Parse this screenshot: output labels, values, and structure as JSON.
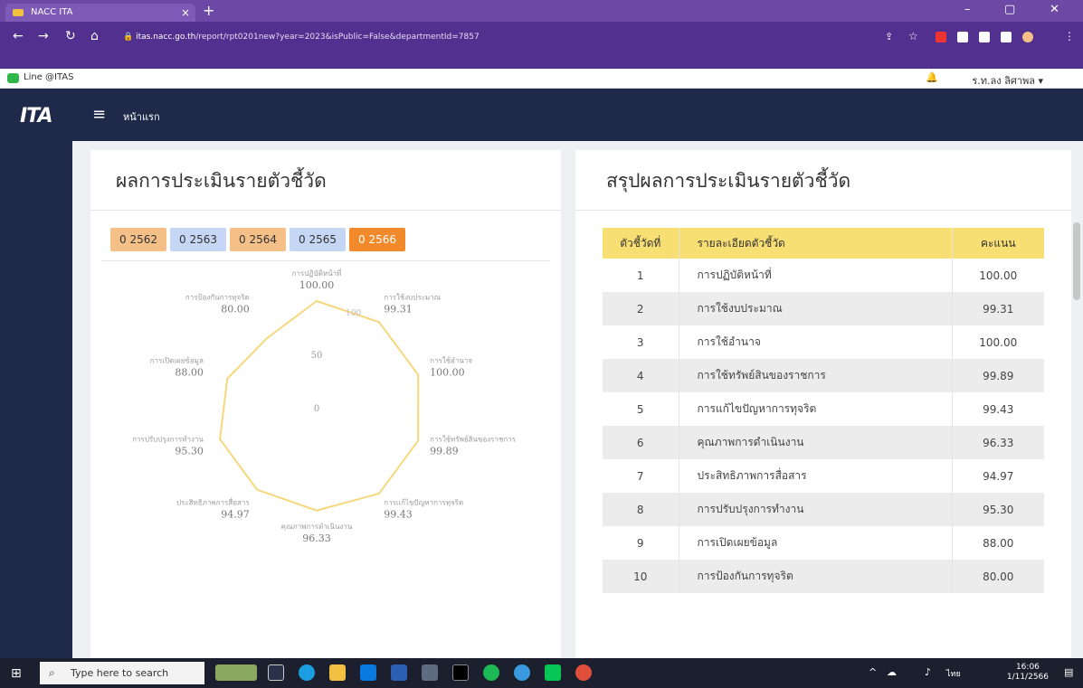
{
  "browser": {
    "tab_title": "NACC ITA",
    "tab_close": "×",
    "new_tab": "+",
    "url_host": "itas.nacc.go.th",
    "url_path": "/report/rpt0201new?year=2023&isPublic=False&departmentId=7857",
    "bookmark": "Line @ITAS"
  },
  "user": {
    "name": "ร.ท.ลง ลิศาพล ▾"
  },
  "app": {
    "logo": "ITA",
    "home_label": "หน้าแรก"
  },
  "left_card": {
    "title": "ผลการประเมินรายตัวชี้วัด",
    "year_tabs": [
      {
        "label": "0 2562",
        "color": "#f4c088"
      },
      {
        "label": "0 2563",
        "color": "#c6d7f5"
      },
      {
        "label": "0 2564",
        "color": "#f4c088"
      },
      {
        "label": "0 2565",
        "color": "#c6d7f5"
      },
      {
        "label": "0 2566",
        "color": "#f28a2c"
      }
    ],
    "radar": {
      "scale_labels": [
        "0",
        "50",
        "100"
      ],
      "line_color": "#f6d77c"
    }
  },
  "right_card": {
    "title": "สรุปผลการประเมินรายตัวชี้วัด",
    "headers": [
      "ตัวชี้วัดที่",
      "รายละเอียดตัวชี้วัด",
      "คะแนน"
    ]
  },
  "chart_data": {
    "type": "radar",
    "title": "ผลการประเมินรายตัวชี้วัด",
    "range": [
      0,
      100
    ],
    "categories": [
      "การปฏิบัติหน้าที่",
      "การใช้งบประมาณ",
      "การใช้อำนาจ",
      "การใช้ทรัพย์สินของราชการ",
      "การแก้ไขปัญหาการทุจริต",
      "คุณภาพการดำเนินงาน",
      "ประสิทธิภาพการสื่อสาร",
      "การปรับปรุงการทำงาน",
      "การเปิดเผยข้อมูล",
      "การป้องกันการทุจริต"
    ],
    "values": [
      100.0,
      99.31,
      100.0,
      99.89,
      99.43,
      96.33,
      94.97,
      95.3,
      88.0,
      80.0
    ],
    "value_labels": [
      "100.00",
      "99.31",
      "100.00",
      "99.89",
      "99.43",
      "96.33",
      "94.97",
      "95.30",
      "88.00",
      "80.00"
    ]
  },
  "taskbar": {
    "search_placeholder": "Type here to search",
    "time": "16:06",
    "date": "1/11/2566",
    "lang": "ไทย"
  }
}
